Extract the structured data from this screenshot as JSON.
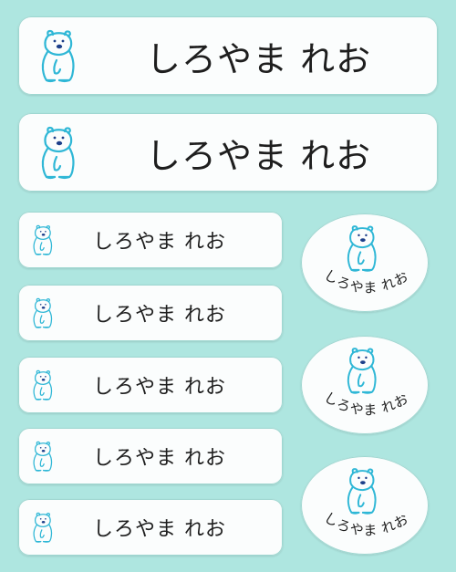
{
  "sheet": {
    "name_text": "しろやま れお",
    "colors": {
      "background": "#aee6e0",
      "label": "#fbfdfd",
      "bear_stroke": "#2fb7d6",
      "bear_nose": "#1d3f8a",
      "text": "#1e1e1e"
    },
    "icon": "polar-bear-icon",
    "large_labels": [
      {
        "name": "しろやま れお"
      },
      {
        "name": "しろやま れお"
      }
    ],
    "small_labels": [
      {
        "name": "しろやま れお"
      },
      {
        "name": "しろやま れお"
      },
      {
        "name": "しろやま れお"
      },
      {
        "name": "しろやま れお"
      },
      {
        "name": "しろやま れお"
      }
    ],
    "oval_labels": [
      {
        "name": "しろやま れお"
      },
      {
        "name": "しろやま れお"
      },
      {
        "name": "しろやま れお"
      }
    ]
  }
}
